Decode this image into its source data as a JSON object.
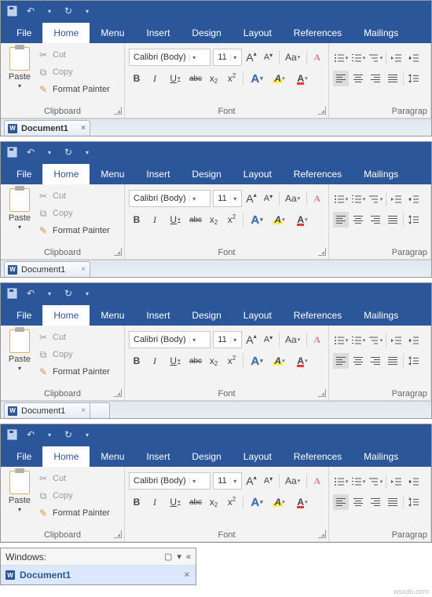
{
  "qat": {
    "save_icon": "save-icon",
    "undo_icon": "undo-icon",
    "redo_icon": "redo-icon",
    "customize_icon": "dropdown-icon"
  },
  "tabs": {
    "file": "File",
    "home": "Home",
    "menu": "Menu",
    "insert": "Insert",
    "design": "Design",
    "layout": "Layout",
    "references": "References",
    "mailings": "Mailings"
  },
  "clipboard": {
    "group_label": "Clipboard",
    "paste_label": "Paste",
    "cut_label": "Cut",
    "copy_label": "Copy",
    "format_painter_label": "Format Painter"
  },
  "font": {
    "group_label": "Font",
    "font_name": "Calibri (Body)",
    "font_size": "11",
    "grow": "A",
    "shrink": "A",
    "case": "Aa",
    "clear": "A",
    "bold": "B",
    "italic": "I",
    "underline": "U",
    "strike": "abc",
    "sub": "x",
    "sup": "x",
    "effects": "A",
    "highlight": "A",
    "color": "A"
  },
  "paragraph": {
    "group_label": "Paragrap"
  },
  "documents": {
    "doc1": "Document1"
  },
  "windows_panel": {
    "title": "Windows:",
    "item": "Document1"
  },
  "watermark": "wsxdn.com"
}
